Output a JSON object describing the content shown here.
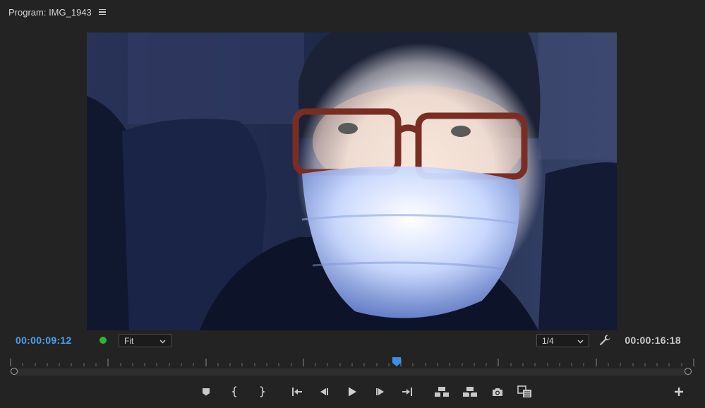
{
  "panel": {
    "title": "Program: IMG_1943"
  },
  "timecode": {
    "current": "00:00:09:12",
    "duration": "00:00:16:18"
  },
  "zoom_select": {
    "value": "Fit"
  },
  "resolution_select": {
    "value": "1/4"
  },
  "playhead": {
    "position_fraction": 0.566
  },
  "colors": {
    "accent_blue": "#4aa3f0",
    "status_green": "#2fb43a",
    "panel_bg": "#232323"
  },
  "icons": {
    "menu": "hamburger-icon",
    "settings": "wrench-icon",
    "add_marker": "marker-icon",
    "mark_in": "mark-in-icon",
    "mark_out": "mark-out-icon",
    "go_to_in": "go-to-in-icon",
    "step_back": "step-back-icon",
    "play": "play-icon",
    "step_forward": "step-forward-icon",
    "go_to_out": "go-to-out-icon",
    "lift": "lift-icon",
    "extract": "extract-icon",
    "export_frame": "camera-icon",
    "compare": "comparison-view-icon",
    "button_editor": "plus-icon"
  }
}
